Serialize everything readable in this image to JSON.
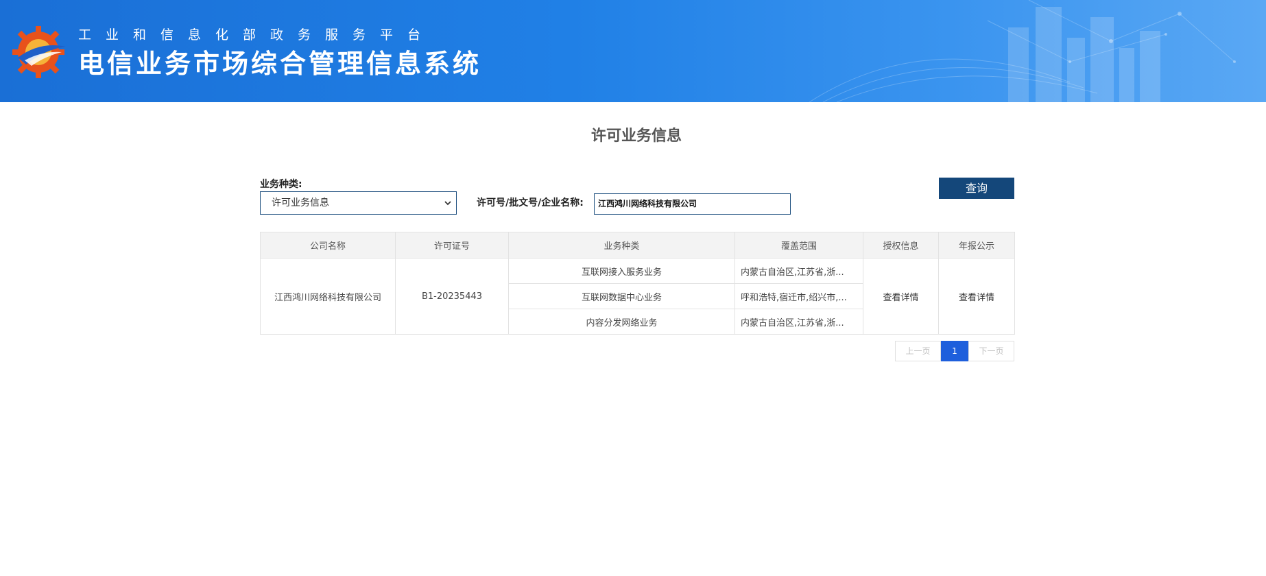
{
  "header": {
    "subtitle": "工业和信息化部政务服务平台",
    "title": "电信业务市场综合管理信息系统"
  },
  "page_title": "许可业务信息",
  "form": {
    "type_label": "业务种类:",
    "type_selected": "许可业务信息",
    "license_label": "许可号/批文号/企业名称:",
    "license_value": "江西鸿川网络科技有限公司",
    "query_label": "查询"
  },
  "table": {
    "headers": [
      "公司名称",
      "许可证号",
      "业务种类",
      "覆盖范围",
      "授权信息",
      "年报公示"
    ],
    "company": "江西鸿川网络科技有限公司",
    "license_no": "B1-20235443",
    "rows": [
      {
        "business": "互联网接入服务业务",
        "scope": "内蒙古自治区,江苏省,浙..."
      },
      {
        "business": "互联网数据中心业务",
        "scope": "呼和浩特,宿迁市,绍兴市,..."
      },
      {
        "business": "内容分发网络业务",
        "scope": "内蒙古自治区,江苏省,浙..."
      }
    ],
    "auth_link": "查看详情",
    "annual_link": "查看详情"
  },
  "pagination": {
    "prev": "上一页",
    "current": "1",
    "next": "下一页"
  },
  "colors": {
    "banner": "#2080e6",
    "query_button": "#14477a",
    "current_page": "#1e5fdc"
  }
}
